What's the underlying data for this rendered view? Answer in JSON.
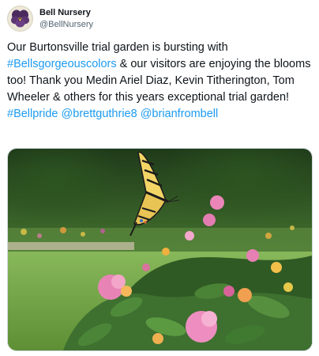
{
  "tweet": {
    "author": {
      "name": "Bell Nursery",
      "handle": "@BellNursery"
    },
    "text": {
      "part1": "Our Burtonsville trial garden is bursting with ",
      "hashtag1": "#Bellsgorgeouscolors",
      "part2": " & our visitors are enjoying the blooms too! Thank you Medin Ariel Diaz, Kevin Titherington, Tom Wheeler & others for this years exceptional trial garden! ",
      "hashtag2": "#Bellpride",
      "space": " ",
      "mention1": "@brettguthrie8",
      "mention2": "@brianfrombell"
    },
    "colors": {
      "link": "#1d9bf0",
      "text": "#0f1419",
      "secondary": "#536471"
    },
    "media": {
      "icon": "butterfly-garden-photo"
    }
  }
}
